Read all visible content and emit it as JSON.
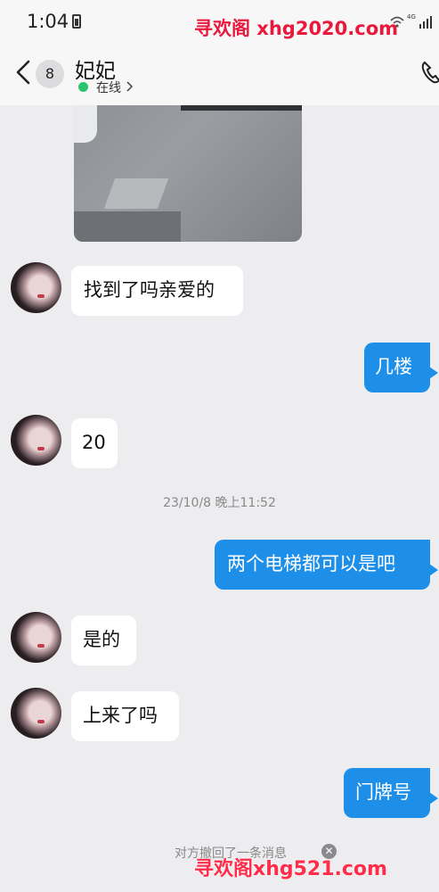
{
  "status_bar": {
    "time": "1:04",
    "network": "4G",
    "watermark": "寻欢阁 xhg2020.com"
  },
  "header": {
    "unread_count": "8",
    "contact_name": "妃妃",
    "status": "在线",
    "status_color": "#2bc46e"
  },
  "messages": [
    {
      "side": "in",
      "text": "找到了吗亲爱的"
    },
    {
      "side": "out",
      "text": "几楼"
    },
    {
      "side": "in",
      "text": "20"
    },
    {
      "side": "out",
      "text": "两个电梯都可以是吧"
    },
    {
      "side": "in",
      "text": "是的"
    },
    {
      "side": "in",
      "text": "上来了吗"
    },
    {
      "side": "out",
      "text": "门牌号"
    }
  ],
  "timestamp": "23/10/8 晚上11:52",
  "recall_notice": "对方撤回了一条消息",
  "footer_watermark": "寻欢阁xhg521.com",
  "colors": {
    "outgoing_bubble": "#1e8fe9",
    "incoming_bubble": "#ffffff",
    "background": "#ededf0",
    "watermark": "#e8193c"
  }
}
